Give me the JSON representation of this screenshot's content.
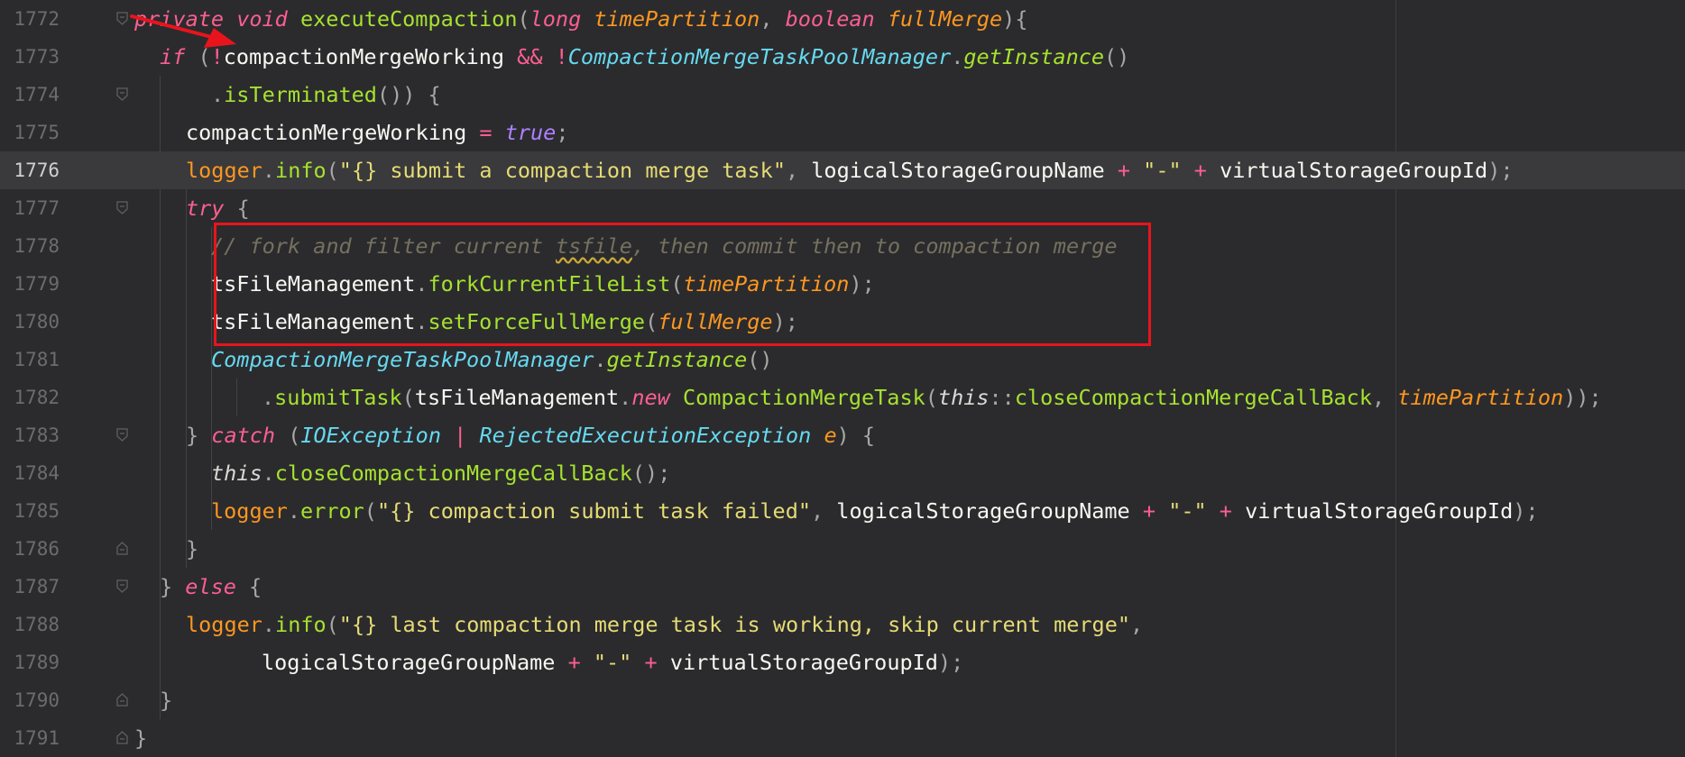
{
  "editor": {
    "language": "java",
    "current_line": 1776,
    "theme_colors": {
      "background": "#2b2b2e",
      "current_line_background": "#3a3a3c",
      "keyword": "#fc5f8f",
      "function": "#a6e22e",
      "class": "#66d9ef",
      "string": "#e6db74",
      "parameter": "#fd971f",
      "constant": "#ae81ff",
      "comment": "#75715e",
      "annotation": "#e8141c"
    },
    "lines": [
      {
        "number": "1772",
        "tokens": [
          {
            "t": "private",
            "c": "kw"
          },
          {
            "t": " ",
            "c": "plain"
          },
          {
            "t": "void",
            "c": "kw"
          },
          {
            "t": " ",
            "c": "plain"
          },
          {
            "t": "executeCompaction",
            "c": "fn"
          },
          {
            "t": "(",
            "c": "punc"
          },
          {
            "t": "long",
            "c": "kw"
          },
          {
            "t": " ",
            "c": "plain"
          },
          {
            "t": "timePartition",
            "c": "param"
          },
          {
            "t": ", ",
            "c": "punc"
          },
          {
            "t": "boolean",
            "c": "kw"
          },
          {
            "t": " ",
            "c": "plain"
          },
          {
            "t": "fullMerge",
            "c": "param"
          },
          {
            "t": "){",
            "c": "punc"
          }
        ]
      },
      {
        "number": "1773",
        "tokens": [
          {
            "t": "if",
            "c": "kw"
          },
          {
            "t": " (",
            "c": "punc"
          },
          {
            "t": "!",
            "c": "op"
          },
          {
            "t": "compactionMergeWorking",
            "c": "plain"
          },
          {
            "t": " ",
            "c": "plain"
          },
          {
            "t": "&&",
            "c": "op"
          },
          {
            "t": " ",
            "c": "plain"
          },
          {
            "t": "!",
            "c": "op"
          },
          {
            "t": "CompactionMergeTaskPoolManager",
            "c": "cls"
          },
          {
            "t": ".",
            "c": "punc"
          },
          {
            "t": "getInstance",
            "c": "fni"
          },
          {
            "t": "()",
            "c": "punc"
          }
        ]
      },
      {
        "number": "1774",
        "tokens": [
          {
            "t": ".",
            "c": "punc"
          },
          {
            "t": "isTerminated",
            "c": "fn"
          },
          {
            "t": "()) {",
            "c": "punc"
          }
        ]
      },
      {
        "number": "1775",
        "tokens": [
          {
            "t": "compactionMergeWorking",
            "c": "plain"
          },
          {
            "t": " ",
            "c": "plain"
          },
          {
            "t": "=",
            "c": "op"
          },
          {
            "t": " ",
            "c": "plain"
          },
          {
            "t": "true",
            "c": "kwv"
          },
          {
            "t": ";",
            "c": "punc"
          }
        ]
      },
      {
        "number": "1776",
        "tokens": [
          {
            "t": "logger",
            "c": "field"
          },
          {
            "t": ".",
            "c": "punc"
          },
          {
            "t": "info",
            "c": "fn"
          },
          {
            "t": "(",
            "c": "punc"
          },
          {
            "t": "\"{} submit a compaction merge task\"",
            "c": "str"
          },
          {
            "t": ", ",
            "c": "punc"
          },
          {
            "t": "logicalStorageGroupName",
            "c": "plain"
          },
          {
            "t": " ",
            "c": "plain"
          },
          {
            "t": "+",
            "c": "op"
          },
          {
            "t": " ",
            "c": "plain"
          },
          {
            "t": "\"-\"",
            "c": "str"
          },
          {
            "t": " ",
            "c": "plain"
          },
          {
            "t": "+",
            "c": "op"
          },
          {
            "t": " ",
            "c": "plain"
          },
          {
            "t": "virtualStorageGroupId",
            "c": "plain"
          },
          {
            "t": ");",
            "c": "punc"
          }
        ]
      },
      {
        "number": "1777",
        "tokens": [
          {
            "t": "try",
            "c": "kw"
          },
          {
            "t": " {",
            "c": "punc"
          }
        ]
      },
      {
        "number": "1778",
        "tokens": [
          {
            "t": "// fork and filter current ",
            "c": "cmt"
          },
          {
            "t": "tsfile",
            "c": "cmt",
            "typo": true
          },
          {
            "t": ", then commit then to compaction merge",
            "c": "cmt"
          }
        ]
      },
      {
        "number": "1779",
        "tokens": [
          {
            "t": "tsFileManagement",
            "c": "plain"
          },
          {
            "t": ".",
            "c": "punc"
          },
          {
            "t": "forkCurrentFileList",
            "c": "fn"
          },
          {
            "t": "(",
            "c": "punc"
          },
          {
            "t": "timePartition",
            "c": "param"
          },
          {
            "t": ");",
            "c": "punc"
          }
        ]
      },
      {
        "number": "1780",
        "tokens": [
          {
            "t": "tsFileManagement",
            "c": "plain"
          },
          {
            "t": ".",
            "c": "punc"
          },
          {
            "t": "setForceFullMerge",
            "c": "fn"
          },
          {
            "t": "(",
            "c": "punc"
          },
          {
            "t": "fullMerge",
            "c": "param"
          },
          {
            "t": ");",
            "c": "punc"
          }
        ]
      },
      {
        "number": "1781",
        "tokens": [
          {
            "t": "CompactionMergeTaskPoolManager",
            "c": "cls"
          },
          {
            "t": ".",
            "c": "punc"
          },
          {
            "t": "getInstance",
            "c": "fni"
          },
          {
            "t": "()",
            "c": "punc"
          }
        ]
      },
      {
        "number": "1782",
        "tokens": [
          {
            "t": ".",
            "c": "punc"
          },
          {
            "t": "submitTask",
            "c": "fn"
          },
          {
            "t": "(",
            "c": "punc"
          },
          {
            "t": "tsFileManagement",
            "c": "plain"
          },
          {
            "t": ".",
            "c": "punc"
          },
          {
            "t": "new",
            "c": "kw"
          },
          {
            "t": " ",
            "c": "plain"
          },
          {
            "t": "CompactionMergeTask",
            "c": "fn"
          },
          {
            "t": "(",
            "c": "punc"
          },
          {
            "t": "this",
            "c": "this"
          },
          {
            "t": "::",
            "c": "punc"
          },
          {
            "t": "closeCompactionMergeCallBack",
            "c": "fn"
          },
          {
            "t": ", ",
            "c": "punc"
          },
          {
            "t": "timePartition",
            "c": "param"
          },
          {
            "t": "));",
            "c": "punc"
          }
        ]
      },
      {
        "number": "1783",
        "tokens": [
          {
            "t": "} ",
            "c": "punc"
          },
          {
            "t": "catch",
            "c": "kw"
          },
          {
            "t": " (",
            "c": "punc"
          },
          {
            "t": "IOException",
            "c": "cls"
          },
          {
            "t": " ",
            "c": "plain"
          },
          {
            "t": "|",
            "c": "op"
          },
          {
            "t": " ",
            "c": "plain"
          },
          {
            "t": "RejectedExecutionException",
            "c": "cls"
          },
          {
            "t": " ",
            "c": "plain"
          },
          {
            "t": "e",
            "c": "param"
          },
          {
            "t": ") {",
            "c": "punc"
          }
        ]
      },
      {
        "number": "1784",
        "tokens": [
          {
            "t": "this",
            "c": "this"
          },
          {
            "t": ".",
            "c": "punc"
          },
          {
            "t": "closeCompactionMergeCallBack",
            "c": "fn"
          },
          {
            "t": "();",
            "c": "punc"
          }
        ]
      },
      {
        "number": "1785",
        "tokens": [
          {
            "t": "logger",
            "c": "field"
          },
          {
            "t": ".",
            "c": "punc"
          },
          {
            "t": "error",
            "c": "fn"
          },
          {
            "t": "(",
            "c": "punc"
          },
          {
            "t": "\"{} compaction submit task failed\"",
            "c": "str"
          },
          {
            "t": ", ",
            "c": "punc"
          },
          {
            "t": "logicalStorageGroupName",
            "c": "plain"
          },
          {
            "t": " ",
            "c": "plain"
          },
          {
            "t": "+",
            "c": "op"
          },
          {
            "t": " ",
            "c": "plain"
          },
          {
            "t": "\"-\"",
            "c": "str"
          },
          {
            "t": " ",
            "c": "plain"
          },
          {
            "t": "+",
            "c": "op"
          },
          {
            "t": " ",
            "c": "plain"
          },
          {
            "t": "virtualStorageGroupId",
            "c": "plain"
          },
          {
            "t": ");",
            "c": "punc"
          }
        ]
      },
      {
        "number": "1786",
        "tokens": [
          {
            "t": "}",
            "c": "punc"
          }
        ]
      },
      {
        "number": "1787",
        "tokens": [
          {
            "t": "} ",
            "c": "punc"
          },
          {
            "t": "else",
            "c": "kw"
          },
          {
            "t": " {",
            "c": "punc"
          }
        ]
      },
      {
        "number": "1788",
        "tokens": [
          {
            "t": "logger",
            "c": "field"
          },
          {
            "t": ".",
            "c": "punc"
          },
          {
            "t": "info",
            "c": "fn"
          },
          {
            "t": "(",
            "c": "punc"
          },
          {
            "t": "\"{} last compaction merge task is working, skip current merge\"",
            "c": "str"
          },
          {
            "t": ",",
            "c": "punc"
          }
        ]
      },
      {
        "number": "1789",
        "tokens": [
          {
            "t": "logicalStorageGroupName",
            "c": "plain"
          },
          {
            "t": " ",
            "c": "plain"
          },
          {
            "t": "+",
            "c": "op"
          },
          {
            "t": " ",
            "c": "plain"
          },
          {
            "t": "\"-\"",
            "c": "str"
          },
          {
            "t": " ",
            "c": "plain"
          },
          {
            "t": "+",
            "c": "op"
          },
          {
            "t": " ",
            "c": "plain"
          },
          {
            "t": "virtualStorageGroupId",
            "c": "plain"
          },
          {
            "t": ");",
            "c": "punc"
          }
        ]
      },
      {
        "number": "1790",
        "tokens": [
          {
            "t": "}",
            "c": "punc"
          }
        ]
      },
      {
        "number": "1791",
        "tokens": [
          {
            "t": "}",
            "c": "punc"
          }
        ]
      }
    ]
  },
  "annotations": {
    "highlight_box": {
      "color": "#e8141c",
      "label": "highlighted code region"
    },
    "arrow": {
      "color": "#e8141c"
    }
  }
}
